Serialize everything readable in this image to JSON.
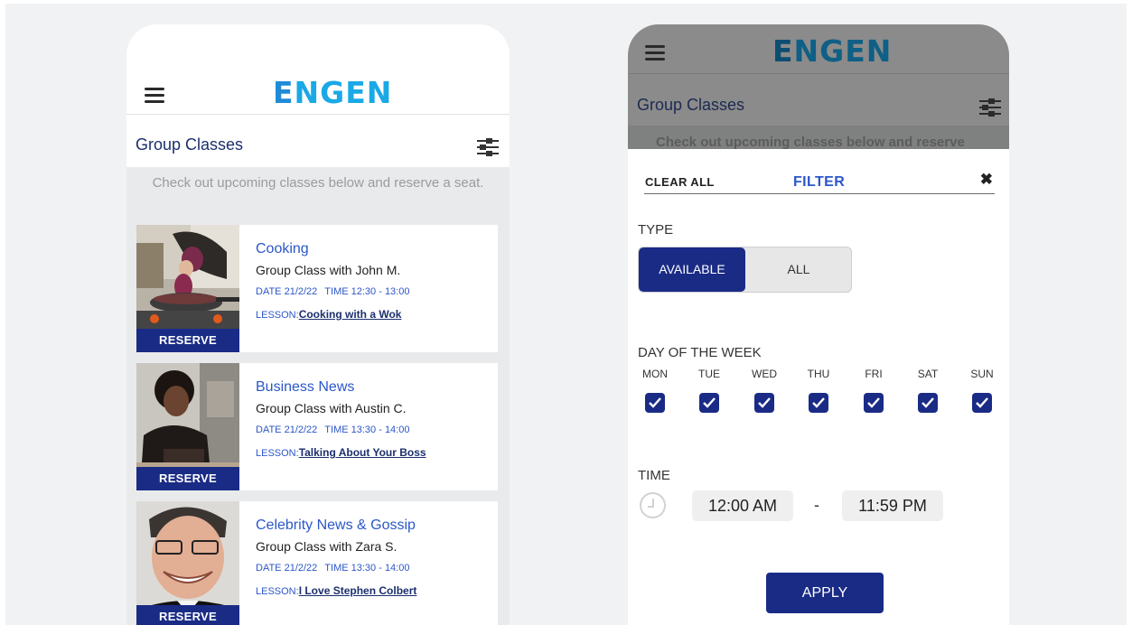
{
  "brand": {
    "logo_e": "E",
    "logo_rest": "NGEN",
    "logo_color": "#1aa9e6"
  },
  "left_screen": {
    "title": "Group Classes",
    "subtitle": "Check out upcoming classes below and reserve a seat.",
    "reserve_label": "RESERVE",
    "classes": [
      {
        "title": "Cooking",
        "teacher": "Group Class with John M.",
        "date_label": "DATE",
        "date": "21/2/22",
        "time_label": "TIME",
        "time": "12:30 - 13:00",
        "lesson_label": "LESSON:",
        "lesson": "Cooking with a Wok"
      },
      {
        "title": "Business News",
        "teacher": "Group Class with Austin C.",
        "date_label": "DATE",
        "date": "21/2/22",
        "time_label": "TIME",
        "time": "13:30 - 14:00",
        "lesson_label": "LESSON:",
        "lesson": "Talking About Your Boss"
      },
      {
        "title": "Celebrity News & Gossip",
        "teacher": "Group Class with Zara S.",
        "date_label": "DATE",
        "date": "21/2/22",
        "time_label": "TIME",
        "time": "13:30 - 14:00",
        "lesson_label": "LESSON:",
        "lesson": "I Love Stephen Colbert"
      }
    ]
  },
  "right_screen": {
    "title": "Group Classes",
    "subtitle_peek": "Check out upcoming classes below and reserve",
    "filter": {
      "clear_all": "CLEAR ALL",
      "title": "FILTER",
      "close": "✖",
      "type_label": "TYPE",
      "type_options": [
        "AVAILABLE",
        "ALL"
      ],
      "type_selected": "AVAILABLE",
      "day_label": "DAY OF THE WEEK",
      "days": [
        "MON",
        "TUE",
        "WED",
        "THU",
        "FRI",
        "SAT",
        "SUN"
      ],
      "days_checked": [
        true,
        true,
        true,
        true,
        true,
        true,
        true
      ],
      "time_label": "TIME",
      "time_from": "12:00 AM",
      "time_sep": "-",
      "time_to": "11:59 PM",
      "apply": "APPLY"
    }
  },
  "colors": {
    "primary": "#1a2b86",
    "link": "#2c57c9",
    "overlay": "#8b8b8b"
  },
  "icons": [
    "menu-icon",
    "filter-sliders-icon",
    "close-icon",
    "checkbox-checked-icon",
    "clock-icon"
  ]
}
